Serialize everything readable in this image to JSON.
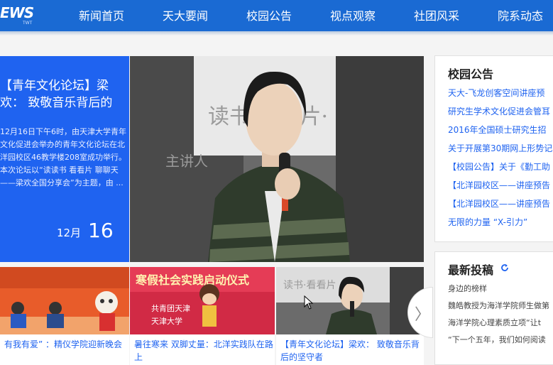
{
  "header": {
    "logo_text": "EWS",
    "logo_sub": "TWT",
    "nav": [
      "新闻首页",
      "天大要闻",
      "校园公告",
      "视点观察",
      "社团风采",
      "院系动态"
    ]
  },
  "feature": {
    "title": "【青年文化论坛】梁欢： 致敬音乐背后的",
    "summary": "12月16日下午6时，由天津大学青年文化促进会举办的青年文化论坛在北洋园校区46教学楼208室成功举行。本次论坛以“读读书 看看片 聊聊天——梁欢全国分享会”为主题，由 ...",
    "month": "12月",
    "day": "16"
  },
  "photo": {
    "banner_text": "读书·看看片·",
    "banner_text2": "主讲人"
  },
  "thumbs": [
    {
      "caption": "有我有爱” ：精仪学院迎新晚会",
      "caption2": ""
    },
    {
      "caption": "暑往寒来 双脚丈量：北洋实践队在路",
      "caption2": "上",
      "banner": "寒假社会实践启动仪式",
      "sub1": "共青团天津",
      "sub2": "天津大学"
    },
    {
      "caption": "【青年文化论坛】梁欢： 致敬音乐背",
      "caption2": "后的坚守者"
    }
  ],
  "next_arrow": "〉",
  "announcements": {
    "title": "校园公告",
    "items": [
      "天大-飞龙创客空间讲座预",
      "研究生学术文化促进会管耳",
      "2016年全国硕士研究生招",
      "关于开展第30期网上形势记",
      "【校园公告】关于《勤工助",
      "【北洋园校区——讲座预告",
      "【北洋园校区——讲座预告",
      "无限的力量 “X-引力”"
    ]
  },
  "submissions": {
    "title": "最新投稿",
    "items": [
      "身边的榜样",
      "魏皓教授为海洋学院师生做第",
      "海洋学院心理素质立项“让t",
      "“下一个五年，我们如何阅读"
    ]
  },
  "colors": {
    "nav_bar": "#1a6ad3",
    "accent": "#1f63f0"
  }
}
